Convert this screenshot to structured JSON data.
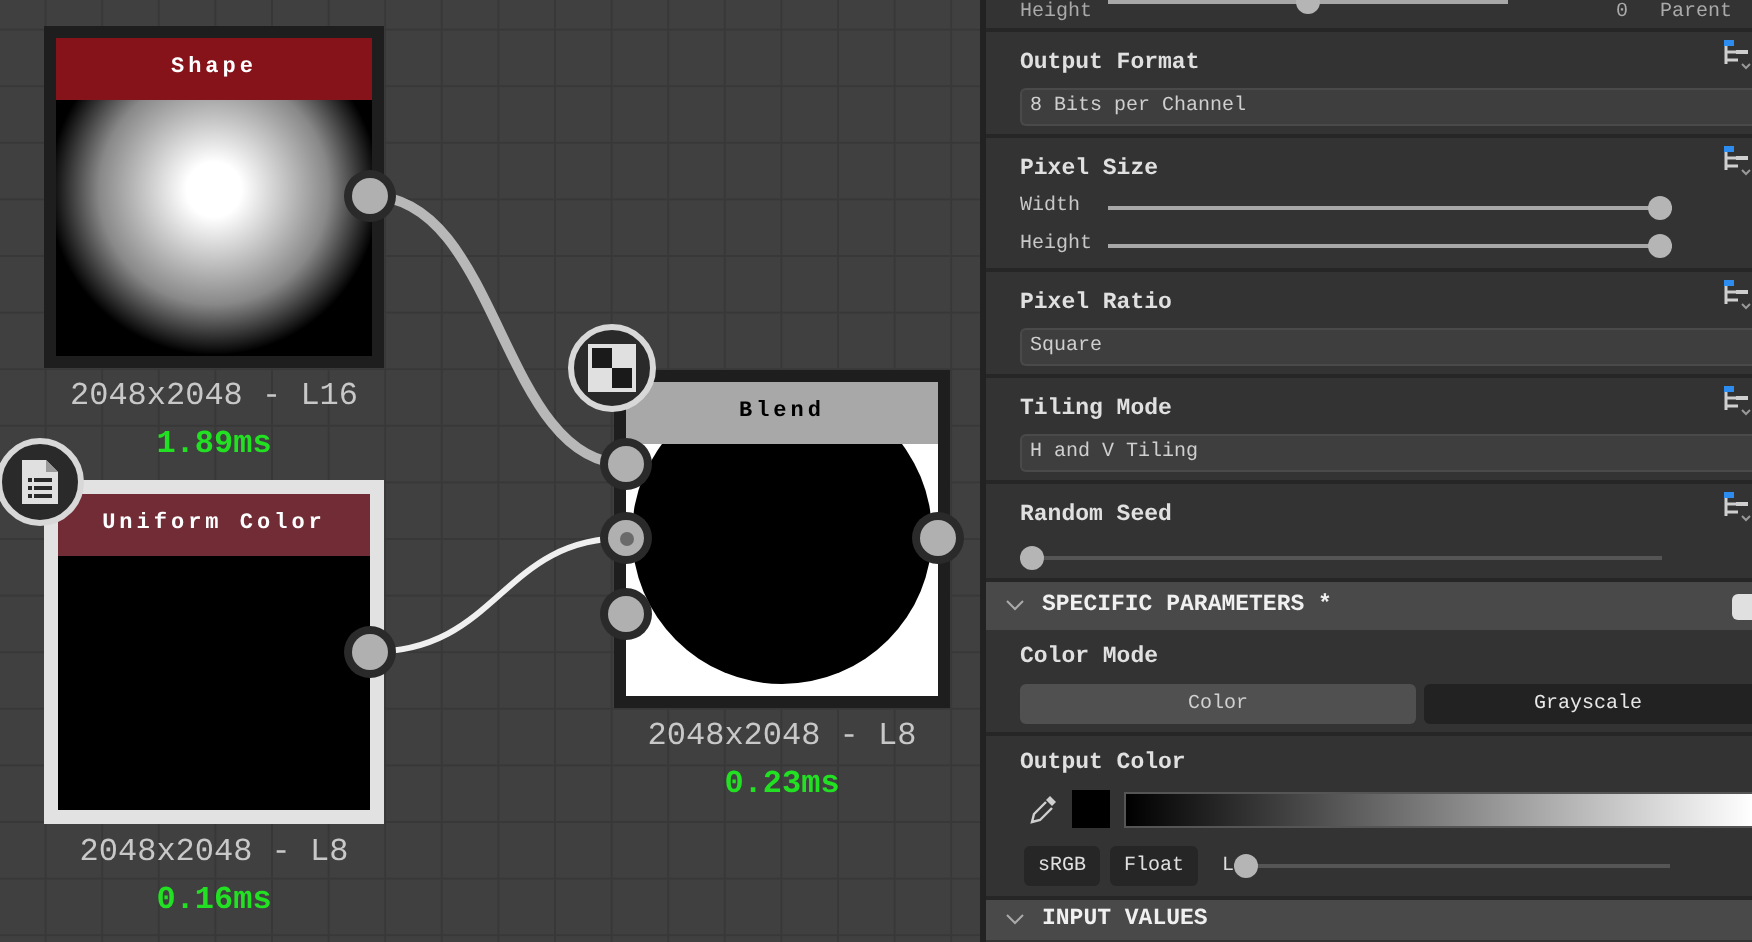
{
  "graph": {
    "nodes": [
      {
        "kind": "shape",
        "title": "Shape",
        "color": "#86121a",
        "selected": false,
        "resolution": "2048x2048 - L16",
        "time": "1.89ms"
      },
      {
        "kind": "uniform",
        "title": "Uniform Color",
        "color": "#722c36",
        "selected": true,
        "resolution": "2048x2048 - L8",
        "time": "0.16ms"
      },
      {
        "kind": "blend",
        "title": "Blend",
        "color": "#a8a8a8",
        "selected": false,
        "resolution": "2048x2048 - L8",
        "time": "0.23ms"
      }
    ]
  },
  "properties": {
    "top_row": {
      "label": "Height",
      "level": 0.5,
      "value": "0",
      "extra": "Parent"
    },
    "sections": [
      {
        "kind": "dropdown",
        "label": "Output Format",
        "value": "8 Bits per Channel"
      },
      {
        "kind": "sliders",
        "label": "Pixel Size",
        "sliders": [
          {
            "label": "Width",
            "level": 1
          },
          {
            "label": "Height",
            "level": 1
          }
        ]
      },
      {
        "kind": "dropdown",
        "label": "Pixel Ratio",
        "value": "Square"
      },
      {
        "kind": "dropdown",
        "label": "Tiling Mode",
        "value": "H and V Tiling"
      },
      {
        "kind": "slider",
        "label": "Random Seed",
        "level": 0
      }
    ],
    "specific_header": "SPECIFIC PARAMETERS *",
    "color_mode": {
      "label": "Color Mode",
      "options": [
        {
          "label": "Color",
          "selected": false
        },
        {
          "label": "Grayscale",
          "selected": true
        }
      ]
    },
    "output_color": {
      "label": "Output Color",
      "buttons": [
        "sRGB",
        "Float"
      ],
      "channel": "L",
      "level": 0
    },
    "input_header": "INPUT VALUES"
  }
}
